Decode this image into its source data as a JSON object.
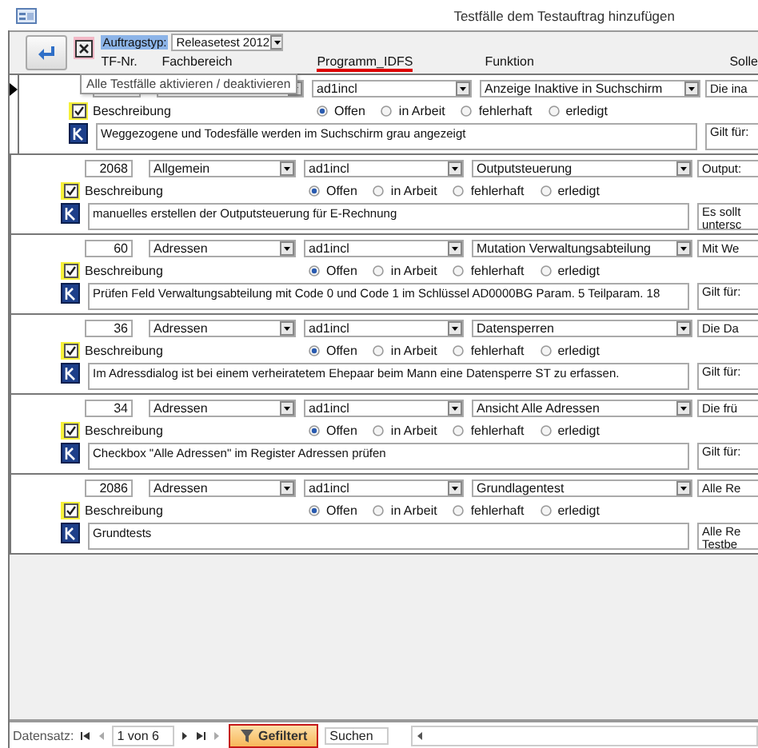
{
  "window": {
    "title": "Testfälle dem Testauftrag hinzufügen"
  },
  "header": {
    "toggle_all": {
      "checked": true
    },
    "order_type": {
      "label": "Auftragstyp:",
      "label_selected": true,
      "value": "Releasetest 2012"
    },
    "columns": [
      {
        "label": "TF-Nr.",
        "highlighted": false
      },
      {
        "label": "Fachbereich",
        "highlighted": false
      },
      {
        "label": "Programm_IDFS",
        "highlighted": true
      },
      {
        "label": "Funktion",
        "highlighted": false
      },
      {
        "label": "Solle",
        "highlighted": false
      }
    ]
  },
  "tooltip": "Alle Testfälle aktivieren / deaktivieren",
  "records": [
    {
      "current": true,
      "checked": true,
      "program": "ad1incl",
      "function": "Anzeige Inaktive in Suchschirm",
      "extra": "Die ina",
      "label": "Beschreibung",
      "status": [
        {
          "label": "Offen",
          "selected": true
        },
        {
          "label": "in Arbeit",
          "selected": false
        },
        {
          "label": "fehlerhaft",
          "selected": false
        },
        {
          "label": "erledigt",
          "selected": false
        }
      ],
      "description": "Weggezogene und Todesfälle werden im Suchschirm grau angezeigt",
      "note": [
        "Gilt für:"
      ]
    },
    {
      "current": false,
      "checked": true,
      "number": "2068",
      "area": "Allgemein",
      "program": "ad1incl",
      "function": "Outputsteuerung",
      "extra": "Output:",
      "label": "Beschreibung",
      "status": [
        {
          "label": "Offen",
          "selected": true
        },
        {
          "label": "in Arbeit",
          "selected": false
        },
        {
          "label": "fehlerhaft",
          "selected": false
        },
        {
          "label": "erledigt",
          "selected": false
        }
      ],
      "description": "manuelles erstellen der Outputsteuerung für E-Rechnung",
      "note": [
        "Es sollt",
        "untersc"
      ]
    },
    {
      "current": false,
      "checked": true,
      "number": "60",
      "area": "Adressen",
      "program": "ad1incl",
      "function": "Mutation Verwaltungsabteilung",
      "extra": "Mit We",
      "label": "Beschreibung",
      "status": [
        {
          "label": "Offen",
          "selected": true
        },
        {
          "label": "in Arbeit",
          "selected": false
        },
        {
          "label": "fehlerhaft",
          "selected": false
        },
        {
          "label": "erledigt",
          "selected": false
        }
      ],
      "description": "Prüfen Feld Verwaltungsabteilung mit Code 0 und Code 1 im Schlüssel AD0000BG Param. 5 Teilparam. 18",
      "note": [
        "Gilt für:"
      ]
    },
    {
      "current": false,
      "checked": true,
      "number": "36",
      "area": "Adressen",
      "program": "ad1incl",
      "function": "Datensperren",
      "extra": "Die Da",
      "label": "Beschreibung",
      "status": [
        {
          "label": "Offen",
          "selected": true
        },
        {
          "label": "in Arbeit",
          "selected": false
        },
        {
          "label": "fehlerhaft",
          "selected": false
        },
        {
          "label": "erledigt",
          "selected": false
        }
      ],
      "description": "Im Adressdialog ist bei einem verheiratetem Ehepaar beim Mann eine Datensperre ST zu erfassen.",
      "note": [
        "Gilt für:"
      ]
    },
    {
      "current": false,
      "checked": true,
      "number": "34",
      "area": "Adressen",
      "program": "ad1incl",
      "function": "Ansicht Alle Adressen",
      "extra": "Die frü",
      "label": "Beschreibung",
      "status": [
        {
          "label": "Offen",
          "selected": true
        },
        {
          "label": "in Arbeit",
          "selected": false
        },
        {
          "label": "fehlerhaft",
          "selected": false
        },
        {
          "label": "erledigt",
          "selected": false
        }
      ],
      "description": "Checkbox \"Alle Adressen\" im Register Adressen prüfen",
      "note": [
        "Gilt für:"
      ]
    },
    {
      "current": false,
      "checked": true,
      "number": "2086",
      "area": "Adressen",
      "program": "ad1incl",
      "function": "Grundlagentest",
      "extra": "Alle Re",
      "label": "Beschreibung",
      "status": [
        {
          "label": "Offen",
          "selected": true
        },
        {
          "label": "in Arbeit",
          "selected": false
        },
        {
          "label": "fehlerhaft",
          "selected": false
        },
        {
          "label": "erledigt",
          "selected": false
        }
      ],
      "description": "Grundtests",
      "note": [
        "Alle Re",
        "Testbe"
      ]
    }
  ],
  "navigation": {
    "label": "Datensatz:",
    "position": "1 von 6",
    "filter": "Gefiltert",
    "search": {
      "placeholder": "Suchen"
    }
  }
}
